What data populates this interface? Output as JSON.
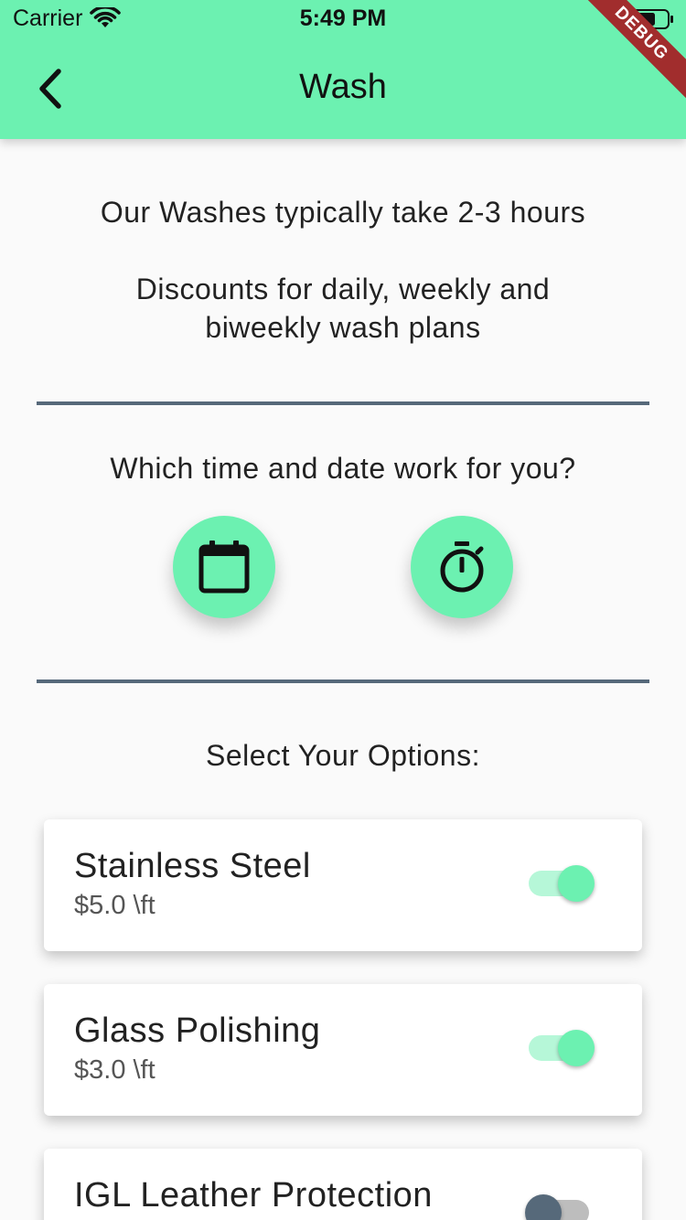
{
  "status_bar": {
    "carrier": "Carrier",
    "time": "5:49 PM"
  },
  "app_bar": {
    "title": "Wash",
    "debug_label": "DEBUG"
  },
  "info": {
    "duration_text": "Our Washes typically take 2-3 hours",
    "discount_line1": "Discounts for daily, weekly and",
    "discount_line2": "biweekly wash plans"
  },
  "schedule": {
    "prompt": "Which time and date work for you?",
    "date_icon": "calendar-icon",
    "time_icon": "timer-icon"
  },
  "options": {
    "heading": "Select Your Options:",
    "items": [
      {
        "title": "Stainless Steel",
        "price": "$5.0 \\ft",
        "enabled": true
      },
      {
        "title": "Glass Polishing",
        "price": "$3.0 \\ft",
        "enabled": true
      },
      {
        "title": "IGL Leather Protection",
        "price": "",
        "enabled": false
      }
    ]
  },
  "colors": {
    "accent": "#6cf1b1",
    "divider": "#56697a",
    "debug": "#a12d2d"
  }
}
